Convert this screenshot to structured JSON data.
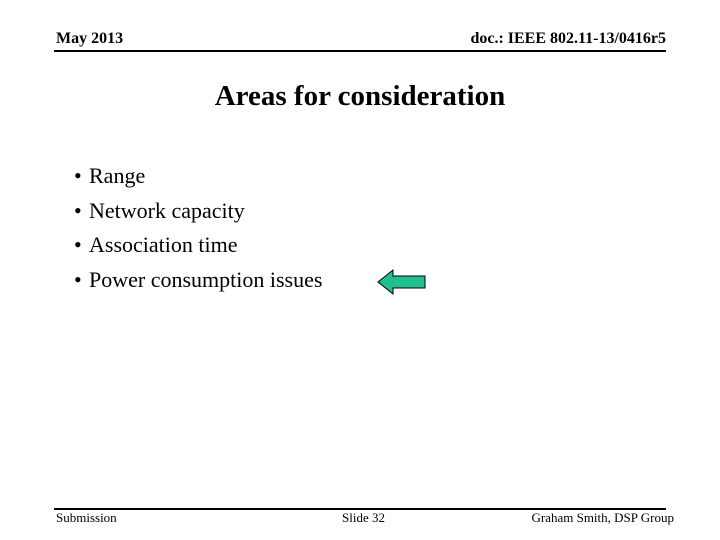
{
  "header": {
    "date": "May 2013",
    "doc_id": "doc.: IEEE 802.11-13/0416r5"
  },
  "title": "Areas for consideration",
  "bullets": [
    {
      "text": "Range"
    },
    {
      "text": "Network capacity"
    },
    {
      "text": "Association time"
    },
    {
      "text": "Power consumption issues"
    }
  ],
  "bullet_glyph": "•",
  "arrow": {
    "icon": "left-arrow-icon",
    "color": "#1fbf8f"
  },
  "footer": {
    "left": "Submission",
    "center": "Slide 32",
    "right": "Graham Smith, DSP Group"
  }
}
